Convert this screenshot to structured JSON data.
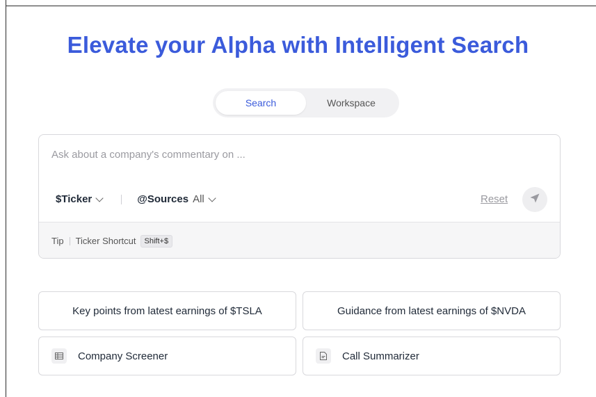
{
  "title": "Elevate your Alpha with Intelligent Search",
  "mode_toggle": {
    "options": [
      "Search",
      "Workspace"
    ],
    "selected": "Search"
  },
  "search": {
    "placeholder": "Ask about a company's commentary on ...",
    "value": "",
    "ticker_label": "$Ticker",
    "sources_label": "@Sources",
    "sources_value": "All",
    "reset_label": "Reset"
  },
  "tip": {
    "label": "Tip",
    "text": "Ticker Shortcut",
    "shortcut": "Shift+$"
  },
  "suggestions": [
    "Key points from latest earnings of $TSLA",
    "Guidance from latest earnings of $NVDA"
  ],
  "tools": [
    {
      "label": "Company Screener",
      "icon": "table-icon"
    },
    {
      "label": "Call Summarizer",
      "icon": "document-icon"
    }
  ],
  "colors": {
    "accent": "#3b5bdb",
    "border": "#d8d8dc",
    "muted": "#9a9aa0"
  }
}
